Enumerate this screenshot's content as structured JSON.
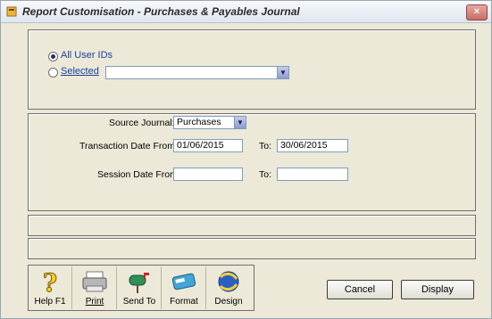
{
  "window": {
    "title": "Report Customisation - Purchases & Payables Journal",
    "close_label": "×"
  },
  "users": {
    "all_label": "All User IDs",
    "all_selected": true,
    "selected_label": "Selected",
    "selected_value": ""
  },
  "filters": {
    "source_journal_label": "Source Journal:",
    "source_journal_value": "Purchases",
    "txn_from_label": "Transaction Date From:",
    "txn_from_value": "01/06/2015",
    "txn_to_label": "To:",
    "txn_to_value": "30/06/2015",
    "session_from_label": "Session Date From:",
    "session_from_value": "",
    "session_to_label": "To:",
    "session_to_value": ""
  },
  "toolbar": {
    "help": "Help F1",
    "print": "Print",
    "send_to": "Send To",
    "format": "Format",
    "design": "Design"
  },
  "actions": {
    "cancel": "Cancel",
    "display": "Display"
  },
  "colors": {
    "dialog_bg": "#ece9d8",
    "accent_blue": "#1b3f9c"
  }
}
